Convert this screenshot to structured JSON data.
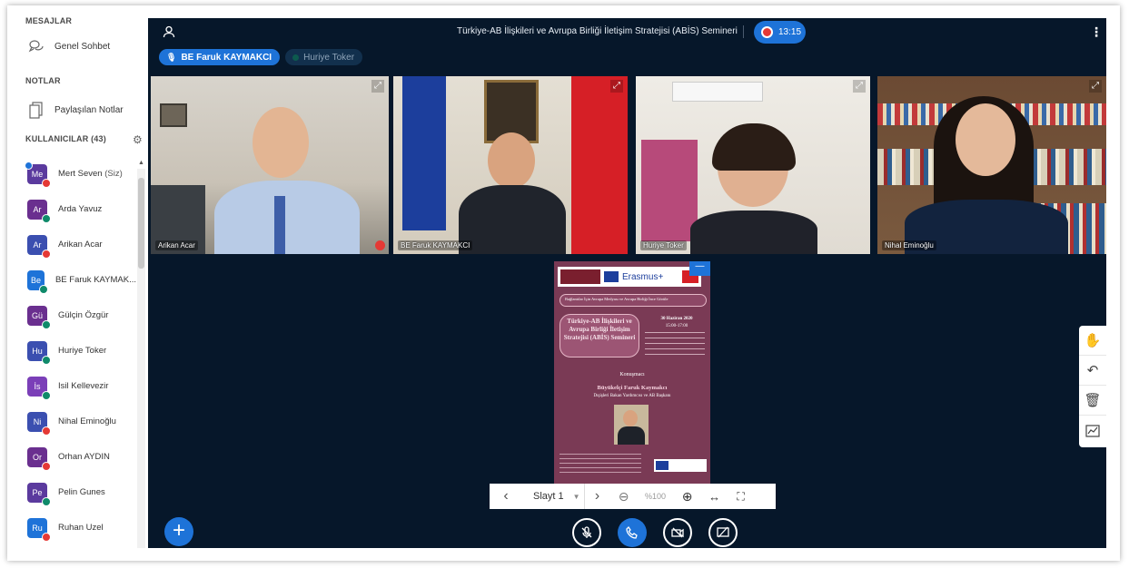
{
  "sidebar": {
    "messages_title": "MESAJLAR",
    "public_chat": "Genel Sohbet",
    "notes_title": "NOTLAR",
    "shared_notes": "Paylaşılan Notlar",
    "users_title": "KULLANICILAR (43)",
    "users": [
      {
        "initials": "Me",
        "name": "Mert Seven",
        "suffix": " (Siz)",
        "color": "#5b3a9e",
        "status": "red",
        "cam": true
      },
      {
        "initials": "Ar",
        "name": "Arda Yavuz",
        "suffix": "",
        "color": "#6a2f8f",
        "status": "green",
        "cam": false
      },
      {
        "initials": "Ar",
        "name": "Arikan Acar",
        "suffix": "",
        "color": "#3b4fb0",
        "status": "red",
        "cam": false
      },
      {
        "initials": "Be",
        "name": "BE Faruk KAYMAK...",
        "suffix": "",
        "color": "#1e73d8",
        "status": "green",
        "cam": false
      },
      {
        "initials": "Gü",
        "name": "Gülçin Özgür",
        "suffix": "",
        "color": "#6a2f8f",
        "status": "green",
        "cam": false
      },
      {
        "initials": "Hu",
        "name": "Huriye Toker",
        "suffix": "",
        "color": "#3b4fb0",
        "status": "green",
        "cam": false
      },
      {
        "initials": "İs",
        "name": "Isil Kellevezir",
        "suffix": "",
        "color": "#7b3fb8",
        "status": "green",
        "cam": false
      },
      {
        "initials": "Ni",
        "name": "Nihal Eminoğlu",
        "suffix": "",
        "color": "#3b4fb0",
        "status": "red",
        "cam": false
      },
      {
        "initials": "Or",
        "name": "Orhan AYDIN",
        "suffix": "",
        "color": "#6a2f8f",
        "status": "red",
        "cam": false
      },
      {
        "initials": "Pe",
        "name": "Pelin Gunes",
        "suffix": "",
        "color": "#5b3a9e",
        "status": "green",
        "cam": false
      },
      {
        "initials": "Ru",
        "name": "Ruhan Uzel",
        "suffix": "",
        "color": "#1e73d8",
        "status": "red",
        "cam": false
      }
    ]
  },
  "topbar": {
    "title": "Türkiye-AB İlişkileri ve Avrupa Birliği İletişim Stratejisi (ABİS) Semineri",
    "recording_time": "13:15"
  },
  "talkers": {
    "active": "BE Faruk KAYMAKCI",
    "idle": "Huriye Toker"
  },
  "videos": [
    {
      "label": "Arikan Acar"
    },
    {
      "label": "BE Faruk KAYMAKCI"
    },
    {
      "label": "Huriye Toker"
    },
    {
      "label": "Nihal Eminoğlu"
    }
  ],
  "slide": {
    "erasmus": "Erasmus+",
    "banner": "Bağlantılar İçin Avrupa Medyası ve Avrupa Birliği İnce Görüle",
    "headline": "Türkiye-AB İlişkileri ve Avrupa Birliği İletişim Stratejisi (ABİS) Semineri",
    "date": "30 Haziran 2020",
    "time": "15:00-17:00",
    "speaker_label": "Konuşmacı",
    "speaker_name": "Büyükelçi Faruk Kaymakcı",
    "speaker_title": "Dışişleri Bakan Yardımcısı ve AB Başkanı"
  },
  "slide_controls": {
    "slide_label": "Slayt 1",
    "zoom": "%100"
  },
  "colors": {
    "accent": "#1e73d8",
    "main_bg": "#06172a",
    "slide_bg": "#7a3a55"
  }
}
